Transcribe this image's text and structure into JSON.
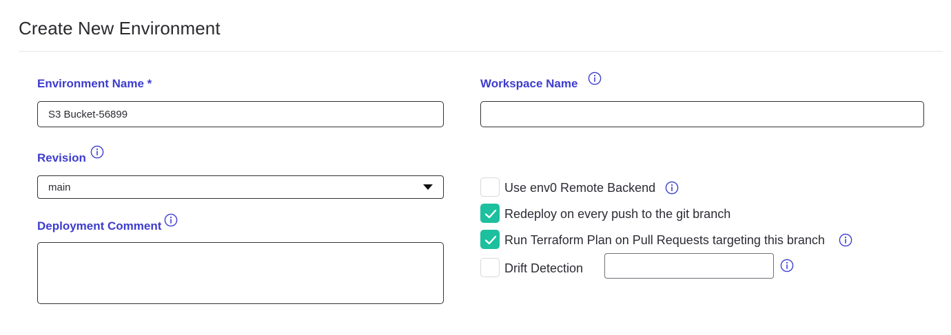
{
  "page": {
    "title": "Create New Environment"
  },
  "form": {
    "environment_name": {
      "label": "Environment Name *",
      "value": "S3 Bucket-56899"
    },
    "workspace_name": {
      "label": "Workspace Name",
      "value": ""
    },
    "revision": {
      "label": "Revision",
      "selected": "main"
    },
    "deployment_comment": {
      "label": "Deployment Comment",
      "value": ""
    }
  },
  "options": [
    {
      "label": "Use env0 Remote Backend",
      "checked": false
    },
    {
      "label": "Redeploy on every push to the git branch",
      "checked": true
    },
    {
      "label": "Run Terraform Plan on Pull Requests targeting this branch",
      "checked": true
    },
    {
      "label": "Drift Detection",
      "checked": false
    }
  ],
  "drift_detection": {
    "value": ""
  },
  "colors": {
    "label": "#3d3ccf",
    "checked": "#1cc09e",
    "info_icon": "#3d3ccf"
  }
}
